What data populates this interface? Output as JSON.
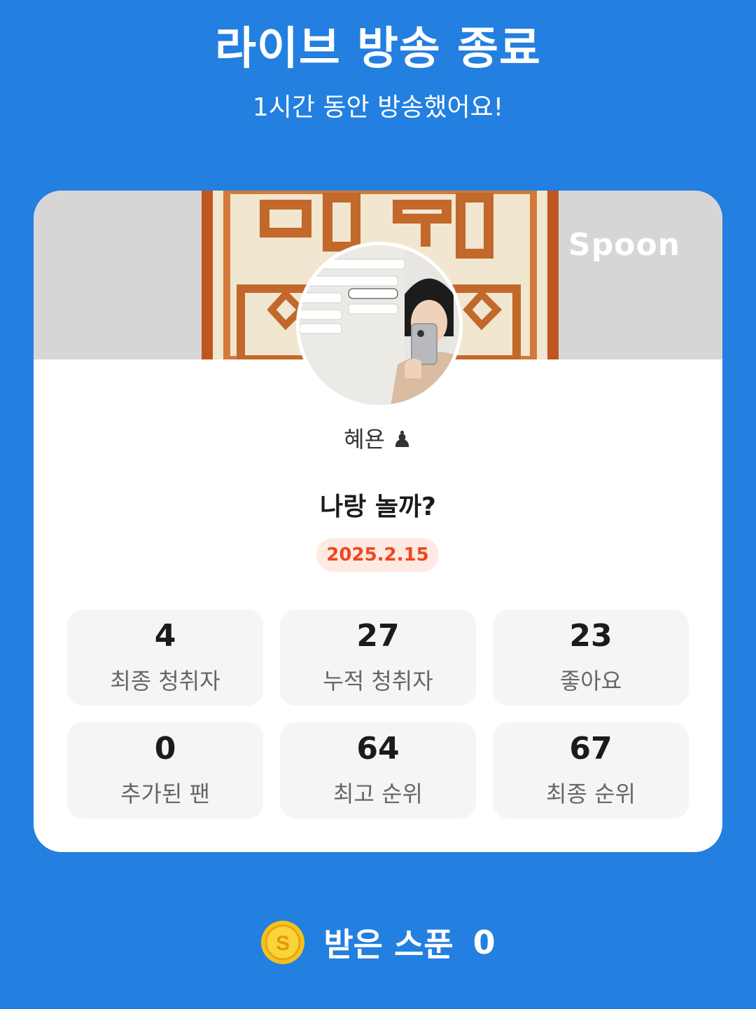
{
  "header": {
    "title": "라이브 방송 종료",
    "subtitle": "1시간 동안 방송했어요!"
  },
  "card": {
    "brand": "Spoon",
    "nickname": "혜욘 ♟",
    "broadcast_title": "나랑 놀까?",
    "date": "2025.2.15",
    "stats": [
      {
        "value": "4",
        "label": "최종 청취자"
      },
      {
        "value": "27",
        "label": "누적 청취자"
      },
      {
        "value": "23",
        "label": "좋아요"
      },
      {
        "value": "0",
        "label": "추가된 팬"
      },
      {
        "value": "64",
        "label": "최고 순위"
      },
      {
        "value": "67",
        "label": "최종 순위"
      }
    ]
  },
  "footer": {
    "received_label": "받은 스푼",
    "received_count": "0",
    "coin_symbol": "S"
  },
  "colors": {
    "background": "#237fe0",
    "date_badge_text": "#f0461c",
    "date_badge_bg": "#ffeae3",
    "coin": "#f5c21b"
  }
}
